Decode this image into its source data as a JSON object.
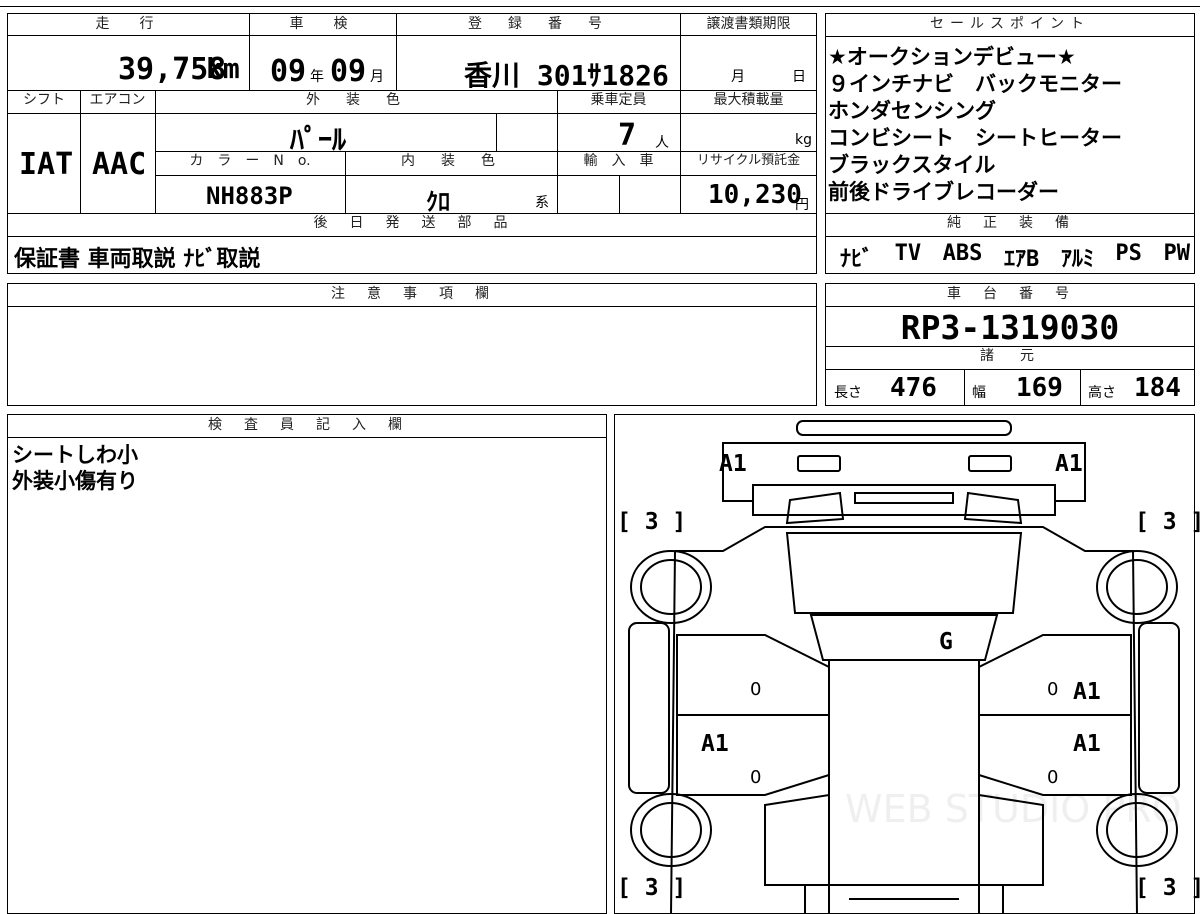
{
  "top_fragment": "",
  "main_table": {
    "headers": {
      "mileage": "走　行",
      "inspection": "車　検",
      "registration": "登　録　番　号",
      "transfer_deadline": "譲渡書類期限",
      "shift": "シフト",
      "aircon": "エアコン",
      "exterior_color": "外　装　色",
      "capacity": "乗車定員",
      "max_load": "最大積載量",
      "color_no": "カ　ラ　ー　N　o.",
      "interior_color": "内　装　色",
      "import": "輸　入　車",
      "recycle": "リサイクル預託金"
    },
    "mileage_value": "39,758",
    "mileage_unit": "km",
    "inspection_year": "09",
    "inspection_year_unit": "年",
    "inspection_month": "09",
    "inspection_month_unit": "月",
    "registration_number": "香川 301ｻ1826",
    "deadline_month_unit": "月",
    "deadline_day_unit": "日",
    "shift_value": "IAT",
    "aircon_value": "AAC",
    "exterior_color_value": "ﾊﾟｰﾙ",
    "capacity_value": "7",
    "capacity_unit": "人",
    "max_load_unit": "kg",
    "color_no_value": "NH883P",
    "interior_color_value": "ｸﾛ",
    "interior_color_suffix": "系",
    "recycle_value": "10,230",
    "recycle_unit": "円",
    "later_parts_header": "後　日　発　送　部　品",
    "later_parts_value": "保証書 車両取説 ﾅﾋﾞ取説"
  },
  "sales_points": {
    "header": "セールスポイント",
    "lines": [
      "★オークションデビュー★",
      "９インチナビ　バックモニター",
      "ホンダセンシング",
      "コンビシート　シートヒーター",
      "ブラックスタイル",
      "前後ドライブレコーダー"
    ]
  },
  "genuine_equipment": {
    "header": "純　正　装　備",
    "items": [
      "ﾅﾋﾞ",
      "TV",
      "ABS",
      "ｴｱB",
      "ｱﾙﾐ",
      "PS",
      "PW"
    ]
  },
  "notes": {
    "header": "注　意　事　項　欄",
    "body": ""
  },
  "chassis": {
    "header": "車　台　番　号",
    "value": "RP3-1319030",
    "specs_header": "諸　元",
    "length_label": "長さ",
    "length_value": "476",
    "width_label": "幅",
    "width_value": "169",
    "height_label": "高さ",
    "height_value": "184"
  },
  "inspector": {
    "header": "検　査　員　記　入　欄",
    "lines": [
      "シートしわ小",
      "外装小傷有り"
    ]
  },
  "diagram": {
    "marks": {
      "front_left": "A1",
      "front_right": "A1",
      "tire_fl": "[ 3 ]",
      "tire_fr": "[ 3 ]",
      "tire_rl": "[ 3 ]",
      "tire_rr": "[ 3 ]",
      "windshield": "G",
      "right_front_door": "A1",
      "left_rear_door": "A1",
      "right_rear_door": "A1",
      "door_zero": "0"
    },
    "watermark": "WEB STUDIO PRO"
  }
}
